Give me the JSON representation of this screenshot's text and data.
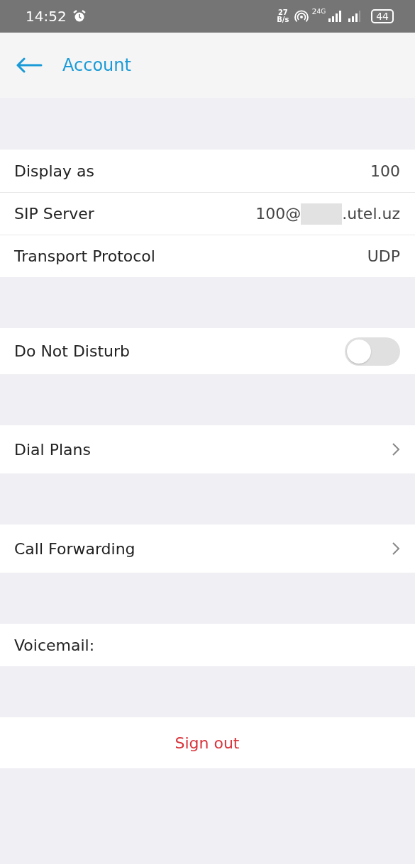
{
  "status_bar": {
    "time": "14:52",
    "net_speed_value": "27",
    "net_speed_unit": "B/s",
    "sim_label": "2",
    "network_type": "4G",
    "battery": "44"
  },
  "header": {
    "title": "Account"
  },
  "groups": [
    {
      "rows": [
        {
          "kind": "value",
          "label": "Display as",
          "value": "100"
        },
        {
          "kind": "redacted",
          "label": "SIP Server",
          "value_prefix": "100@",
          "value_suffix": ".utel.uz"
        },
        {
          "kind": "value",
          "label": "Transport Protocol",
          "value": "UDP"
        }
      ]
    },
    {
      "rows": [
        {
          "kind": "toggle",
          "label": "Do Not Disturb",
          "on": false
        }
      ]
    },
    {
      "rows": [
        {
          "kind": "link",
          "label": "Dial Plans"
        }
      ]
    },
    {
      "rows": [
        {
          "kind": "link",
          "label": "Call Forwarding"
        }
      ]
    },
    {
      "rows": [
        {
          "kind": "plain",
          "label": "Voicemail:"
        }
      ]
    },
    {
      "rows": [
        {
          "kind": "action",
          "label": "Sign out"
        }
      ]
    }
  ]
}
